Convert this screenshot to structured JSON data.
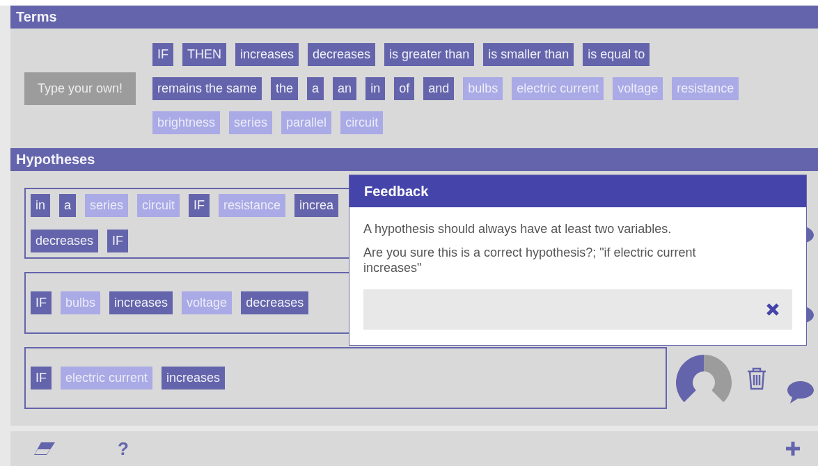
{
  "terms": {
    "title": "Terms",
    "type_own_button": "Type your own!",
    "items": [
      {
        "text": "IF",
        "kind": "connector"
      },
      {
        "text": "THEN",
        "kind": "connector"
      },
      {
        "text": "increases",
        "kind": "connector"
      },
      {
        "text": "decreases",
        "kind": "connector"
      },
      {
        "text": "is greater than",
        "kind": "connector"
      },
      {
        "text": "is smaller than",
        "kind": "connector"
      },
      {
        "text": "is equal to",
        "kind": "connector"
      },
      {
        "text": "remains the same",
        "kind": "connector"
      },
      {
        "text": "the",
        "kind": "connector"
      },
      {
        "text": "a",
        "kind": "connector"
      },
      {
        "text": "an",
        "kind": "connector"
      },
      {
        "text": "in",
        "kind": "connector"
      },
      {
        "text": "of",
        "kind": "connector"
      },
      {
        "text": "and",
        "kind": "connector"
      },
      {
        "text": "bulbs",
        "kind": "variable"
      },
      {
        "text": "electric current",
        "kind": "variable"
      },
      {
        "text": "voltage",
        "kind": "variable"
      },
      {
        "text": "resistance",
        "kind": "variable"
      },
      {
        "text": "brightness",
        "kind": "variable"
      },
      {
        "text": "series",
        "kind": "variable"
      },
      {
        "text": "parallel",
        "kind": "variable"
      },
      {
        "text": "circuit",
        "kind": "variable"
      }
    ]
  },
  "hypotheses": {
    "title": "Hypotheses",
    "items": [
      {
        "lines": [
          [
            {
              "text": "in",
              "kind": "connector"
            },
            {
              "text": "a",
              "kind": "connector"
            },
            {
              "text": "series",
              "kind": "variable"
            },
            {
              "text": "circuit",
              "kind": "variable"
            },
            {
              "text": "IF",
              "kind": "connector"
            },
            {
              "text": "resistance",
              "kind": "variable"
            },
            {
              "text": "increa",
              "kind": "connector"
            }
          ],
          [
            {
              "text": "decreases",
              "kind": "connector"
            },
            {
              "text": "IF",
              "kind": "connector"
            }
          ]
        ]
      },
      {
        "lines": [
          [
            {
              "text": "IF",
              "kind": "connector"
            },
            {
              "text": "bulbs",
              "kind": "variable"
            },
            {
              "text": "increases",
              "kind": "connector"
            },
            {
              "text": "voltage",
              "kind": "variable"
            },
            {
              "text": "decreases",
              "kind": "connector"
            }
          ]
        ]
      },
      {
        "lines": [
          [
            {
              "text": "IF",
              "kind": "connector"
            },
            {
              "text": "electric current",
              "kind": "variable"
            },
            {
              "text": "increases",
              "kind": "connector"
            }
          ]
        ],
        "gauge": true
      }
    ]
  },
  "feedback": {
    "title": "Feedback",
    "messages": [
      "A hypothesis should always have at least two variables.",
      "Are you sure this is a correct hypothesis?; \"if electric current increases\""
    ]
  },
  "toolbar": {
    "help_label": "?"
  }
}
